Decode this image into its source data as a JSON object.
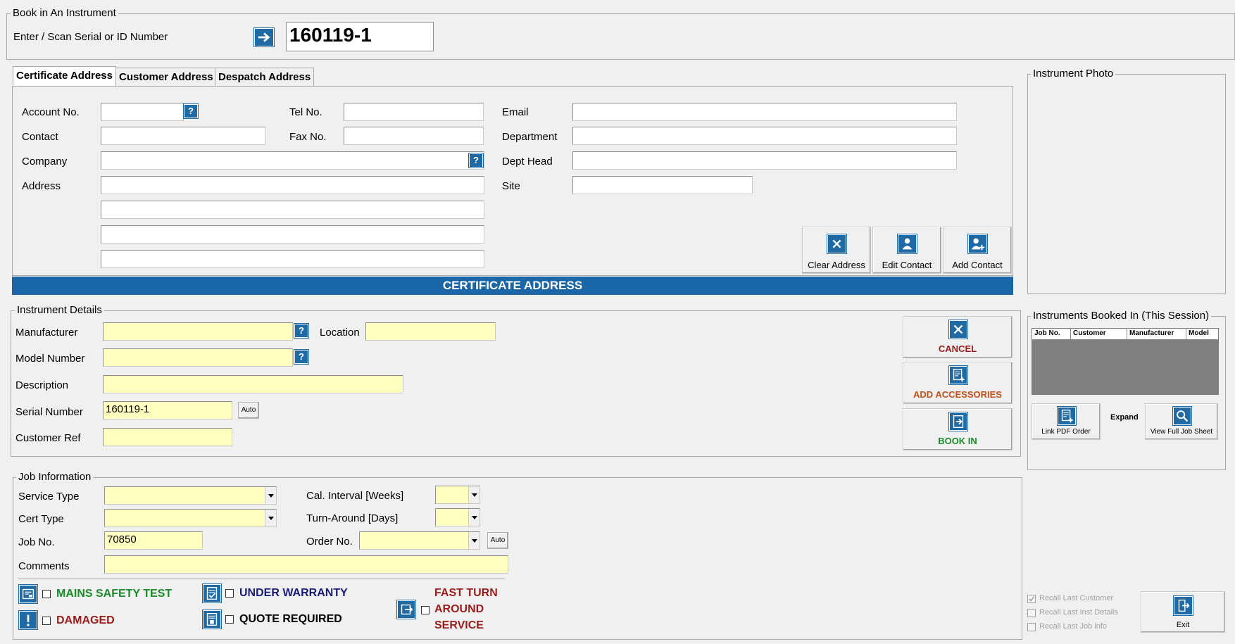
{
  "book_in": {
    "title": "Book in An Instrument",
    "serial_label": "Enter / Scan Serial or ID Number",
    "serial_value": "160119-1"
  },
  "tabs": [
    "Certificate Address",
    "Customer Address",
    "Despatch Address"
  ],
  "address": {
    "account_label": "Account No.",
    "contact_label": "Contact",
    "company_label": "Company",
    "address_label": "Address",
    "tel_label": "Tel No.",
    "fax_label": "Fax No.",
    "email_label": "Email",
    "department_label": "Department",
    "dept_head_label": "Dept Head",
    "site_label": "Site",
    "lookup_glyph": "?",
    "clear_label": "Clear Address",
    "edit_label": "Edit Contact",
    "add_label": "Add Contact",
    "banner": "CERTIFICATE ADDRESS",
    "banner_color": "#1a66a6"
  },
  "instrument_photo": {
    "title": "Instrument Photo"
  },
  "instrument_details": {
    "title": "Instrument Details",
    "manufacturer_label": "Manufacturer",
    "location_label": "Location",
    "model_label": "Model Number",
    "description_label": "Description",
    "serial_label": "Serial Number",
    "serial_value": "160119-1",
    "customer_ref_label": "Customer Ref",
    "auto_label": "Auto",
    "cancel_label": "CANCEL",
    "accessories_label": "ADD ACCESSORIES",
    "book_in_label": "BOOK IN",
    "cancel_color": "#9b1b1b",
    "accessories_color": "#c0501a",
    "book_in_color": "#1a8a2a"
  },
  "session": {
    "title": "Instruments Booked In (This Session)",
    "columns": [
      "Job No.",
      "Customer",
      "Manufacturer",
      "Model"
    ],
    "link_pdf_label": "Link PDF Order",
    "expand_label": "Expand",
    "view_full_label": "View Full Job Sheet"
  },
  "job_info": {
    "title": "Job Information",
    "service_type_label": "Service Type",
    "cert_type_label": "Cert Type",
    "job_no_label": "Job No.",
    "job_no_value": "70850",
    "comments_label": "Comments",
    "cal_interval_label": "Cal. Interval [Weeks]",
    "turnaround_label": "Turn-Around [Days]",
    "order_no_label": "Order No.",
    "auto_label": "Auto",
    "mains_label": "MAINS SAFETY TEST",
    "damaged_label": "DAMAGED",
    "warranty_label": "UNDER WARRANTY",
    "quote_label": "QUOTE REQUIRED",
    "fast_turn_line1": "FAST TURN",
    "fast_turn_line2": "AROUND",
    "fast_turn_line3": "SERVICE",
    "mains_color": "#1a8a2a",
    "damaged_color": "#9b1b1b",
    "warranty_color": "#1a1a7a",
    "fast_color": "#9b1b1b"
  },
  "recall": {
    "last_customer": "Recall Last Customer",
    "last_inst": "Recall Last Inst Details",
    "last_job": "Recall Last Job info",
    "last_customer_checked": true,
    "exit_label": "Exit"
  }
}
